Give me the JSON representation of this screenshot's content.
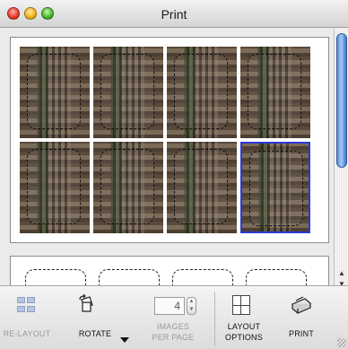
{
  "window": {
    "title": "Print"
  },
  "toolbar": {
    "relayout_label": "RE-LAYOUT",
    "rotate_label": "ROTATE",
    "images_per_page_value": "4",
    "images_per_page_label_1": "IMAGES",
    "images_per_page_label_2": "PER PAGE",
    "layout_options_label_1": "LAYOUT",
    "layout_options_label_2": "OPTIONS",
    "print_label": "PRINT"
  },
  "pages": [
    {
      "images": 8,
      "selected_index": 7
    },
    {
      "images": 4
    }
  ],
  "colors": {
    "selection": "#2a3ad8",
    "scroll_thumb": "#5a8ed6"
  }
}
